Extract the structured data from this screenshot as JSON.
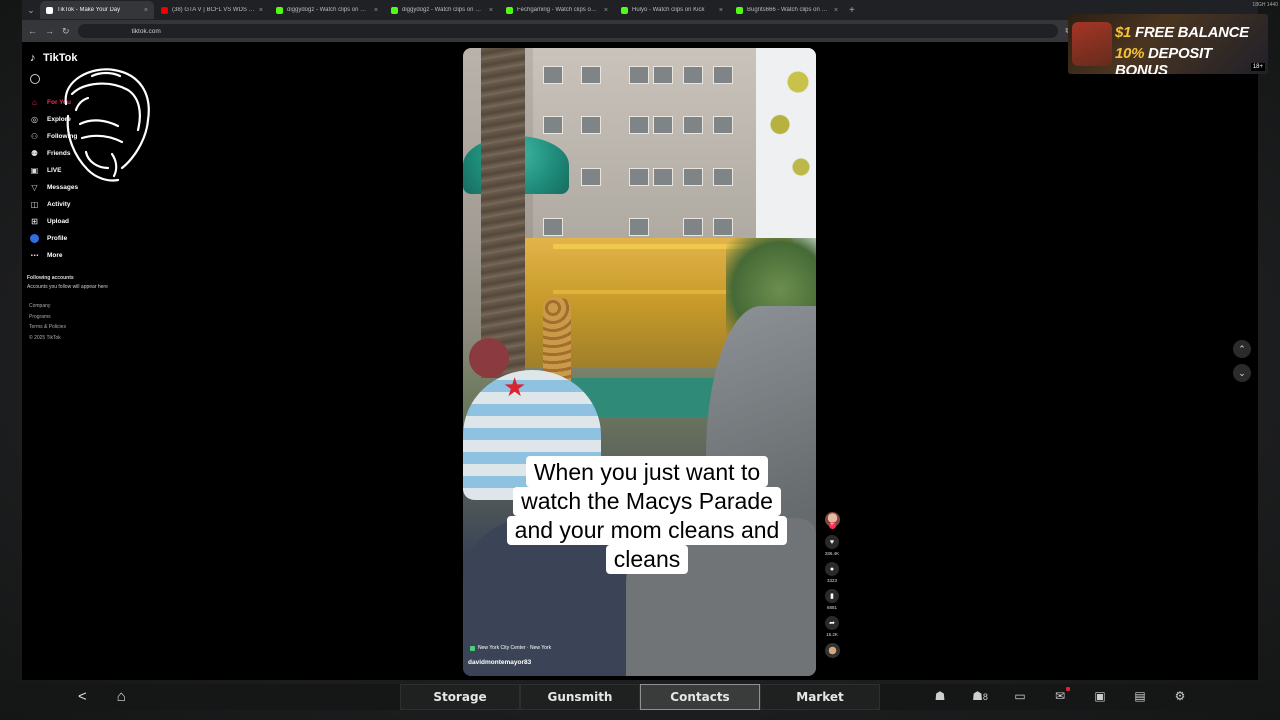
{
  "browser": {
    "tabs": [
      {
        "title": "TikTok - Make Your Day",
        "color": "#ffffff",
        "active": true
      },
      {
        "title": "(38) GTA V | BCFL VS WDS [Pre...",
        "color": "#ff0000"
      },
      {
        "title": "diggydogz - Watch clips on Kic...",
        "color": "#53fc18"
      },
      {
        "title": "diggydogz - Watch clips on Kic...",
        "color": "#53fc18"
      },
      {
        "title": "Fechgaming - Watch clips on K...",
        "color": "#53fc18"
      },
      {
        "title": "Hulyo - Watch clips on Kick",
        "color": "#53fc18"
      },
      {
        "title": "Bugrits666 - Watch clips on Ki...",
        "color": "#53fc18"
      }
    ],
    "address": "tiktok.com",
    "corner_text": "18GH 1440"
  },
  "sidebar": {
    "brand": "TikTok",
    "nav": [
      {
        "label": "For You",
        "icon": "home-icon",
        "selected": true
      },
      {
        "label": "Explore",
        "icon": "compass-icon"
      },
      {
        "label": "Following",
        "icon": "following-icon"
      },
      {
        "label": "Friends",
        "icon": "friends-icon"
      },
      {
        "label": "LIVE",
        "icon": "live-icon"
      },
      {
        "label": "Messages",
        "icon": "messages-icon"
      },
      {
        "label": "Activity",
        "icon": "activity-icon"
      },
      {
        "label": "Upload",
        "icon": "upload-icon"
      },
      {
        "label": "Profile",
        "icon": "profile-icon"
      },
      {
        "label": "More",
        "icon": "more-icon"
      }
    ],
    "following_title": "Following accounts",
    "following_sub": "Accounts you follow will appear here",
    "footer": [
      "Company",
      "Programs",
      "Terms & Policies",
      "© 2025 TikTok"
    ]
  },
  "video": {
    "caption_lines": [
      "When you just want to",
      "watch the Macys Parade",
      "and your mom cleans and",
      "cleans"
    ],
    "location": "New York City Center · New York",
    "author": "davidmontemayor83"
  },
  "actions": {
    "likes": "286.4K",
    "comments": "3323",
    "saves": "6881",
    "shares": "15.2K"
  },
  "ad": {
    "line1_prefix": "$1",
    "line1_rest": "FREE BALANCE",
    "line2_prefix": "10%",
    "line2_rest": "DEPOSIT BONUS",
    "badge": "18+"
  },
  "game_bar": {
    "tabs": [
      "Storage",
      "Gunsmith",
      "Contacts",
      "Market"
    ],
    "active_tab": "Contacts",
    "friends_count": "8"
  }
}
